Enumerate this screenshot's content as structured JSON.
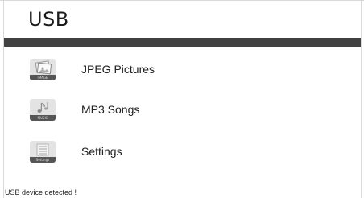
{
  "header": {
    "title": "USB"
  },
  "menu": {
    "items": [
      {
        "label": "JPEG Pictures",
        "icon": "picture-icon",
        "icon_caption": "IMAGE"
      },
      {
        "label": "MP3 Songs",
        "icon": "music-note-icon",
        "icon_caption": "MUSIC"
      },
      {
        "label": "Settings",
        "icon": "settings-icon",
        "icon_caption": "Settings"
      }
    ]
  },
  "status": {
    "message": "USB device detected !"
  },
  "colors": {
    "header_bar": "#414141",
    "icon_background": "#e3e3e3",
    "text": "#1a1a1a"
  }
}
